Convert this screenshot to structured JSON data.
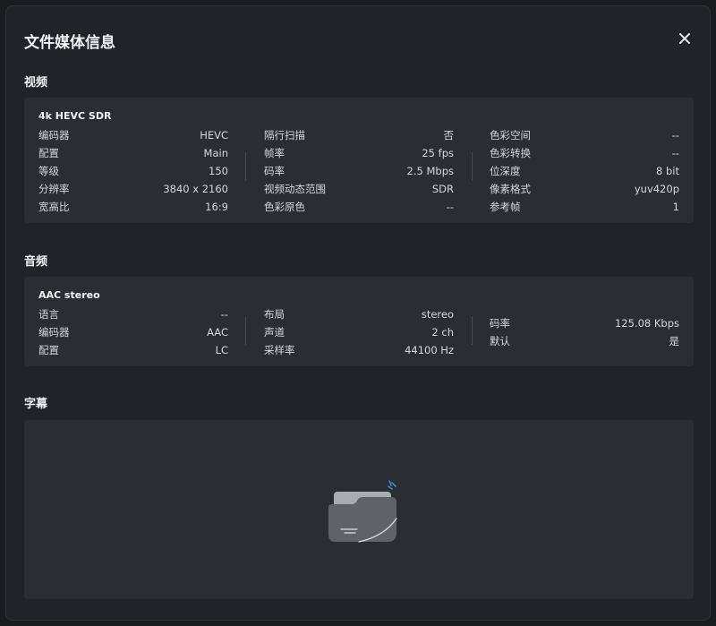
{
  "dialog": {
    "title": "文件媒体信息"
  },
  "video": {
    "section_title": "视频",
    "stream_title": "4k HEVC SDR",
    "columns": [
      [
        {
          "label": "编码器",
          "value": "HEVC"
        },
        {
          "label": "配置",
          "value": "Main"
        },
        {
          "label": "等级",
          "value": "150"
        },
        {
          "label": "分辨率",
          "value": "3840 x 2160"
        },
        {
          "label": "宽高比",
          "value": "16:9"
        }
      ],
      [
        {
          "label": "隔行扫描",
          "value": "否"
        },
        {
          "label": "帧率",
          "value": "25 fps"
        },
        {
          "label": "码率",
          "value": "2.5 Mbps"
        },
        {
          "label": "视频动态范围",
          "value": "SDR"
        },
        {
          "label": "色彩原色",
          "value": "--"
        }
      ],
      [
        {
          "label": "色彩空间",
          "value": "--"
        },
        {
          "label": "色彩转换",
          "value": "--"
        },
        {
          "label": "位深度",
          "value": "8 bit"
        },
        {
          "label": "像素格式",
          "value": "yuv420p"
        },
        {
          "label": "参考帧",
          "value": "1"
        }
      ]
    ]
  },
  "audio": {
    "section_title": "音频",
    "stream_title": "AAC stereo",
    "columns": [
      [
        {
          "label": "语言",
          "value": "--"
        },
        {
          "label": "编码器",
          "value": "AAC"
        },
        {
          "label": "配置",
          "value": "LC"
        }
      ],
      [
        {
          "label": "布局",
          "value": "stereo"
        },
        {
          "label": "声道",
          "value": "2 ch"
        },
        {
          "label": "采样率",
          "value": "44100 Hz"
        }
      ],
      [
        {
          "label": "码率",
          "value": "125.08 Kbps"
        },
        {
          "label": "默认",
          "value": "是"
        }
      ]
    ]
  },
  "subtitles": {
    "section_title": "字幕",
    "empty_icon": "empty-folder-icon"
  },
  "colors": {
    "dialog_bg": "#202429",
    "card_bg": "#2a2e32",
    "accent": "#3d8bd6"
  }
}
